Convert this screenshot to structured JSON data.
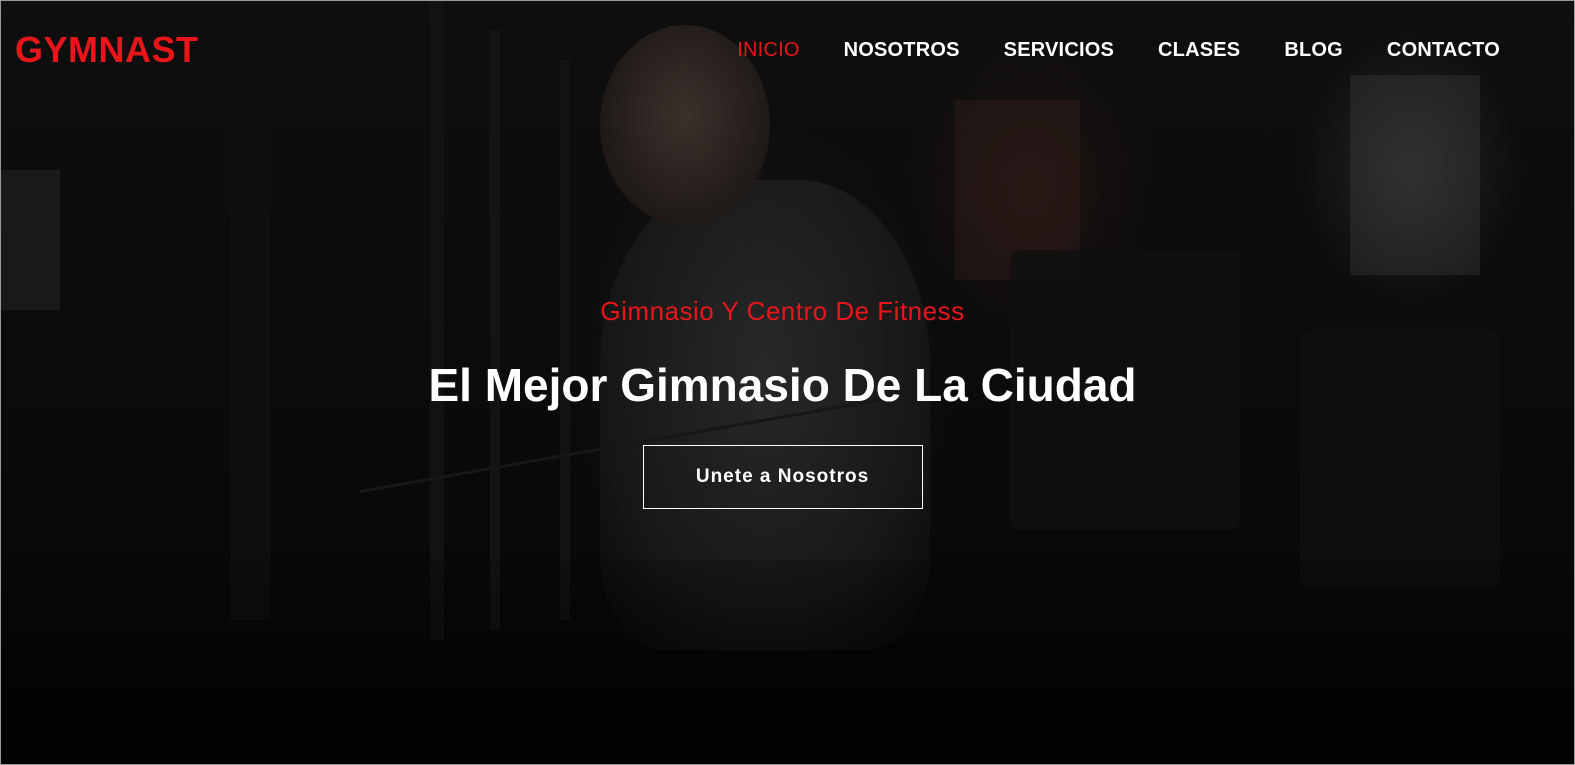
{
  "brand": {
    "logo_text": "GYMNAST",
    "accent_color": "#e8161b"
  },
  "nav": {
    "items": [
      {
        "label": "INICIO",
        "active": true
      },
      {
        "label": "NOSOTROS",
        "active": false
      },
      {
        "label": "SERVICIOS",
        "active": false
      },
      {
        "label": "CLASES",
        "active": false
      },
      {
        "label": "BLOG",
        "active": false
      },
      {
        "label": "CONTACTO",
        "active": false
      }
    ]
  },
  "hero": {
    "subtitle": "Gimnasio Y Centro De Fitness",
    "title": "El Mejor Gimnasio De La Ciudad",
    "cta_label": "Unete a Nosotros",
    "background_image": "gym-athlete-cable-machine"
  }
}
